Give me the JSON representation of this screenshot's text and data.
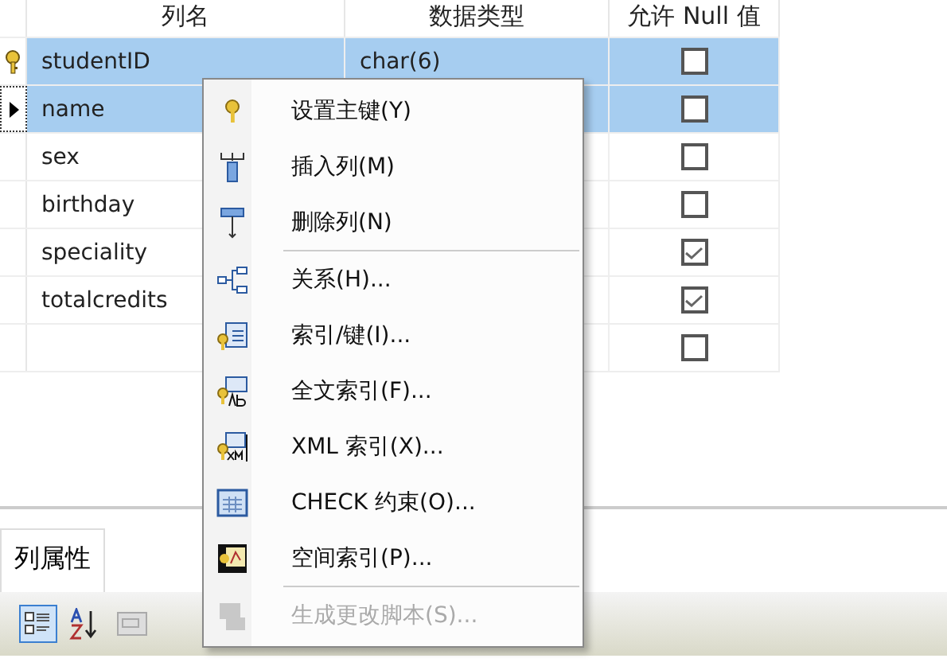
{
  "table": {
    "columns": [
      "列名",
      "数据类型",
      "允许 Null 值"
    ],
    "rows": [
      {
        "primary_key": true,
        "current": false,
        "name": "studentID",
        "type": "char(6)",
        "allow_null": false,
        "selected": true
      },
      {
        "primary_key": false,
        "current": true,
        "name": "name",
        "allow_null": false,
        "selected": true
      },
      {
        "primary_key": false,
        "current": false,
        "name": "sex",
        "allow_null": false,
        "selected": false
      },
      {
        "primary_key": false,
        "current": false,
        "name": "birthday",
        "allow_null": false,
        "selected": false
      },
      {
        "primary_key": false,
        "current": false,
        "name": "speciality",
        "allow_null": true,
        "selected": false
      },
      {
        "primary_key": false,
        "current": false,
        "name": "totalcredits",
        "allow_null": true,
        "selected": false
      },
      {
        "primary_key": false,
        "current": false,
        "allow_null": false,
        "selected": false
      }
    ]
  },
  "context_menu": [
    {
      "kind": "key",
      "label": "设置主键(Y)",
      "disabled": false,
      "separator_after": false
    },
    {
      "kind": "insert",
      "label": "插入列(M)",
      "disabled": false,
      "separator_after": false
    },
    {
      "kind": "delete",
      "label": "删除列(N)",
      "disabled": false,
      "separator_after": true
    },
    {
      "kind": "relation",
      "label": "关系(H)...",
      "disabled": false,
      "separator_after": false
    },
    {
      "kind": "index",
      "label": "索引/键(I)...",
      "disabled": false,
      "separator_after": false
    },
    {
      "kind": "fulltext",
      "label": "全文索引(F)...",
      "disabled": false,
      "separator_after": false
    },
    {
      "kind": "xml",
      "label": "XML 索引(X)...",
      "disabled": false,
      "separator_after": false
    },
    {
      "kind": "check",
      "label": "CHECK 约束(O)...",
      "disabled": false,
      "separator_after": false
    },
    {
      "kind": "spatial",
      "label": "空间索引(P)...",
      "disabled": false,
      "separator_after": true
    },
    {
      "kind": "script",
      "label": "生成更改脚本(S)...",
      "disabled": true,
      "separator_after": false
    }
  ],
  "properties_panel": {
    "tab": "列属性",
    "toolbar": [
      {
        "kind": "categorized",
        "selected": true
      },
      {
        "kind": "alphabetical",
        "selected": false
      },
      {
        "kind": "pages",
        "selected": false
      }
    ]
  }
}
